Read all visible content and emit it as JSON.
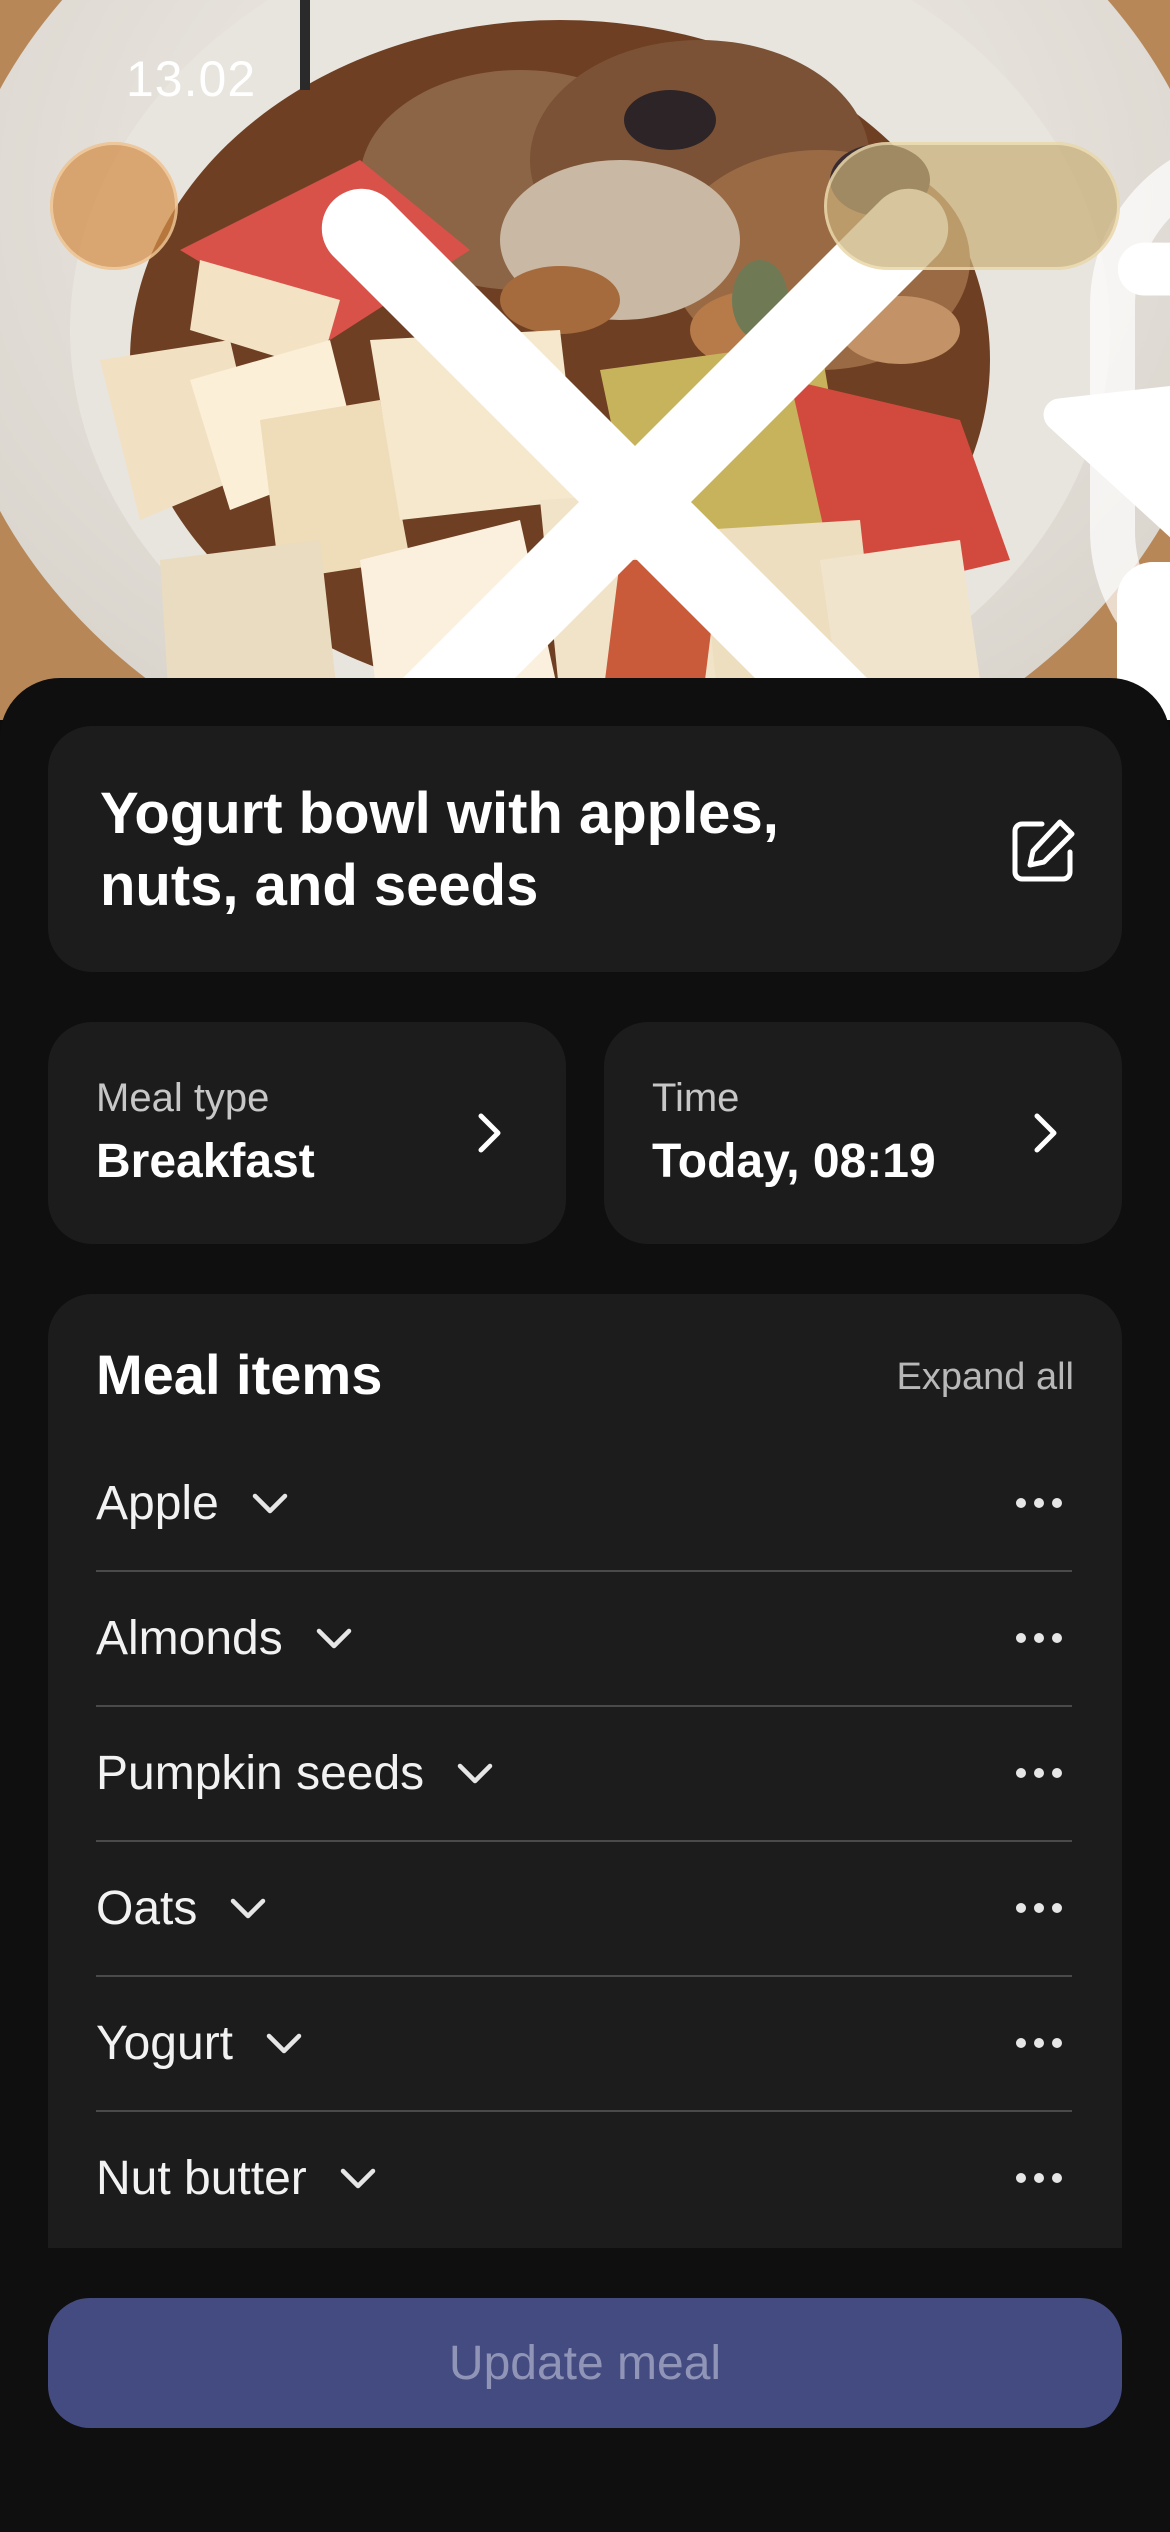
{
  "status_bar": {
    "time": "13.02",
    "icons": [
      "signal-icon",
      "wifi-icon",
      "battery-icon"
    ]
  },
  "header": {
    "actions": [
      "close-icon",
      "trash-icon",
      "star-icon"
    ]
  },
  "meal": {
    "title": "Yogurt bowl with apples, nuts, and seeds",
    "meal_type_label": "Meal type",
    "meal_type_value": "Breakfast",
    "time_label": "Time",
    "time_value": "Today, 08:19"
  },
  "items_section": {
    "title": "Meal items",
    "expand_label": "Expand all",
    "items": [
      {
        "name": "Apple"
      },
      {
        "name": "Almonds"
      },
      {
        "name": "Pumpkin seeds"
      },
      {
        "name": "Oats"
      },
      {
        "name": "Yogurt"
      },
      {
        "name": "Nut butter"
      }
    ]
  },
  "footer": {
    "update_label": "Update meal"
  },
  "colors": {
    "accent_button": "#444b80",
    "card": "#1c1c1c",
    "background": "#0f0f0f"
  }
}
